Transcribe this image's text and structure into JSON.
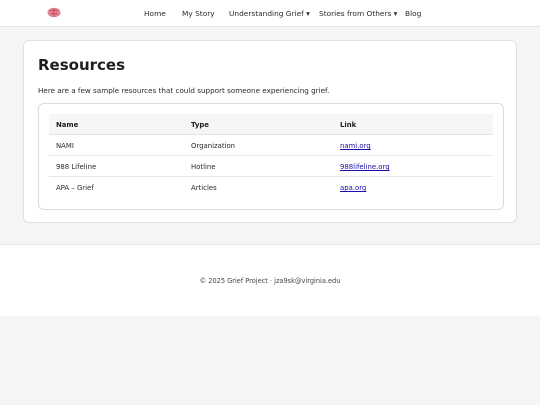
{
  "nav": {
    "logo_icon": "brain-icon",
    "items": [
      {
        "label": "Home"
      },
      {
        "label": "My Story"
      },
      {
        "label": "Understanding Grief ▾"
      },
      {
        "label": "Stories from Others ▾"
      },
      {
        "label": "Blog"
      }
    ]
  },
  "main": {
    "title": "Resources",
    "intro": "Here are a few sample resources that could support someone experiencing grief.",
    "table": {
      "headers": [
        "Name",
        "Type",
        "Link"
      ],
      "rows": [
        {
          "name": "NAMI",
          "type": "Organization",
          "link": "nami.org"
        },
        {
          "name": "988 Lifeline",
          "type": "Hotline",
          "link": "988lifeline.org"
        },
        {
          "name": "APA – Grief",
          "type": "Articles",
          "link": "apa.org"
        }
      ]
    }
  },
  "footer": {
    "text": "© 2025 Grief Project · jza9sk@virginia.edu"
  },
  "colors": {
    "link": "#1a0dab",
    "logo": "#e06a78"
  }
}
